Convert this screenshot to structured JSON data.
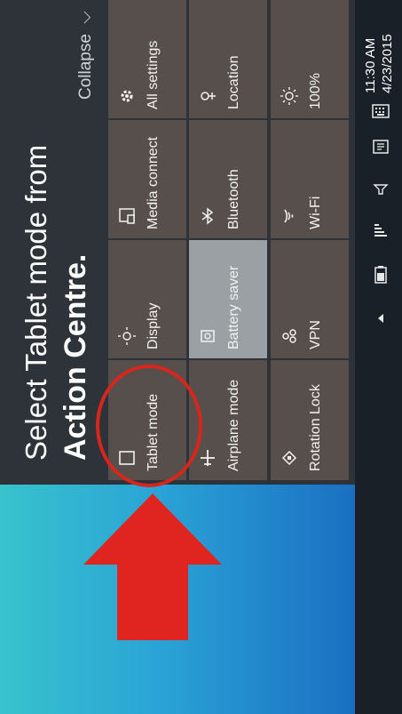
{
  "hint": {
    "line1": "Select Tablet mode from",
    "line2": "Action Centre."
  },
  "panel": {
    "collapse_label": "Collapse"
  },
  "tiles": [
    {
      "label": "Tablet mode",
      "icon": "tablet-icon"
    },
    {
      "label": "Display",
      "icon": "display-icon"
    },
    {
      "label": "Media connect",
      "icon": "media-connect-icon"
    },
    {
      "label": "All settings",
      "icon": "gear-icon"
    },
    {
      "label": "Airplane mode",
      "icon": "airplane-icon"
    },
    {
      "label": "Battery saver",
      "icon": "battery-saver-icon"
    },
    {
      "label": "Bluetooth",
      "icon": "bluetooth-icon"
    },
    {
      "label": "Location",
      "icon": "location-icon"
    },
    {
      "label": "Rotation Lock",
      "icon": "rotation-lock-icon"
    },
    {
      "label": "VPN",
      "icon": "vpn-icon"
    },
    {
      "label": "Wi-Fi",
      "icon": "wifi-icon"
    },
    {
      "label": "100%",
      "icon": "brightness-icon"
    }
  ],
  "taskbar": {
    "time": "11:30 AM",
    "date": "4/23/2015"
  },
  "colors": {
    "accent_annotation": "#d8261e",
    "tile_bg": "#574f4b",
    "tile_active_bg": "#9aa0a3"
  }
}
